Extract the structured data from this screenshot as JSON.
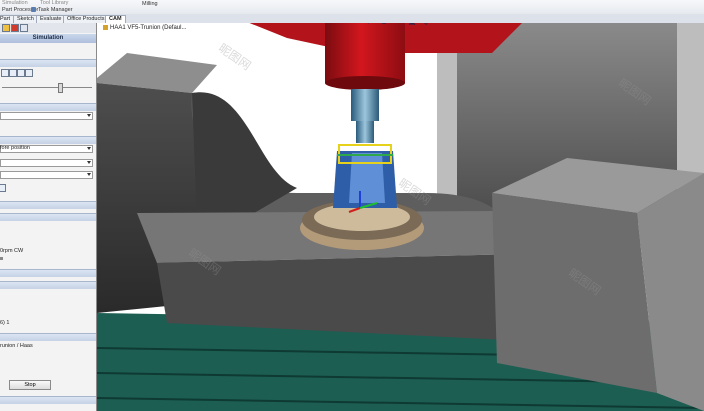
{
  "ribbon": {
    "items": [
      "Simulation",
      "Tool Library",
      "Milling",
      "Part Processor",
      "Task Manager"
    ]
  },
  "tabs": [
    {
      "label": "Part"
    },
    {
      "label": "Sketch"
    },
    {
      "label": "Evaluate"
    },
    {
      "label": "Office Products"
    },
    {
      "label": "CAM",
      "active": true
    }
  ],
  "panel": {
    "title": "Simulation",
    "option_partial": "fore position",
    "field_partial": "0rpm CW",
    "machine_partial": "runion / Haas",
    "value_partial": "6) 1",
    "stop_button": "Stop"
  },
  "viewport": {
    "tree_label": "HAA1 VF5-Trunion (Defaul...",
    "watermark": "昵图网",
    "colors": {
      "spindle_head": "#c8141c",
      "fixture": "#6a6a6a",
      "table": "#1d6a5a",
      "part": "#2f5ea8"
    }
  }
}
